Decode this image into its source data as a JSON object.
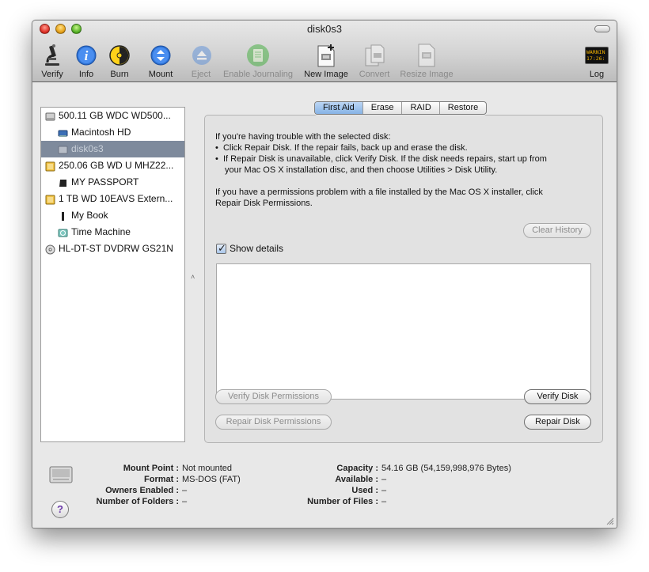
{
  "window": {
    "title": "disk0s3"
  },
  "toolbar": {
    "verify": "Verify",
    "info": "Info",
    "burn": "Burn",
    "mount": "Mount",
    "eject": "Eject",
    "enable_journaling": "Enable Journaling",
    "new_image": "New Image",
    "convert": "Convert",
    "resize_image": "Resize Image",
    "log": "Log",
    "log_icon_text": "WARNIN\n17:26:"
  },
  "sidebar": {
    "items": [
      {
        "label": "500.11 GB WDC WD500...",
        "level": 0,
        "icon": "internal-disk-icon"
      },
      {
        "label": "Macintosh HD",
        "level": 1,
        "icon": "volume-icon"
      },
      {
        "label": "disk0s3",
        "level": 1,
        "icon": "volume-icon",
        "selected": true
      },
      {
        "label": "250.06 GB WD U MHZ22...",
        "level": 0,
        "icon": "external-disk-icon"
      },
      {
        "label": "MY PASSPORT",
        "level": 1,
        "icon": "volume-icon"
      },
      {
        "label": "1 TB WD 10EAVS Extern...",
        "level": 0,
        "icon": "external-disk-icon"
      },
      {
        "label": "My Book",
        "level": 1,
        "icon": "volume-icon"
      },
      {
        "label": "Time Machine",
        "level": 1,
        "icon": "time-machine-icon"
      },
      {
        "label": "HL-DT-ST DVDRW GS21N",
        "level": 0,
        "icon": "optical-drive-icon"
      }
    ]
  },
  "tabs": [
    "First Aid",
    "Erase",
    "RAID",
    "Restore"
  ],
  "first_aid": {
    "intro": "If you're having trouble with the selected disk:",
    "bullet1": "Click Repair Disk. If the repair fails, back up and erase the disk.",
    "bullet2_line1": "If Repair Disk is unavailable, click Verify Disk. If the disk needs repairs, start up from",
    "bullet2_line2": "your Mac OS X installation disc, and then choose Utilities > Disk Utility.",
    "perm_line1": "If you have a permissions problem with a file installed by the Mac OS X installer, click",
    "perm_line2": "Repair Disk Permissions.",
    "show_details": "Show details",
    "clear_history": "Clear History",
    "verify_permissions": "Verify Disk Permissions",
    "repair_permissions": "Repair Disk Permissions",
    "verify_disk": "Verify Disk",
    "repair_disk": "Repair Disk"
  },
  "info": {
    "mount_point_label": "Mount Point :",
    "mount_point": "Not mounted",
    "format_label": "Format :",
    "format": "MS-DOS (FAT)",
    "owners_label": "Owners Enabled :",
    "owners": "–",
    "folders_label": "Number of Folders :",
    "folders": "–",
    "capacity_label": "Capacity :",
    "capacity": "54.16 GB (54,159,998,976 Bytes)",
    "available_label": "Available :",
    "available": "–",
    "used_label": "Used :",
    "used": "–",
    "files_label": "Number of Files :",
    "files": "–",
    "help": "?"
  },
  "colors": {
    "selection": "#7e8a9c",
    "active_tab": "#86b3e6"
  }
}
